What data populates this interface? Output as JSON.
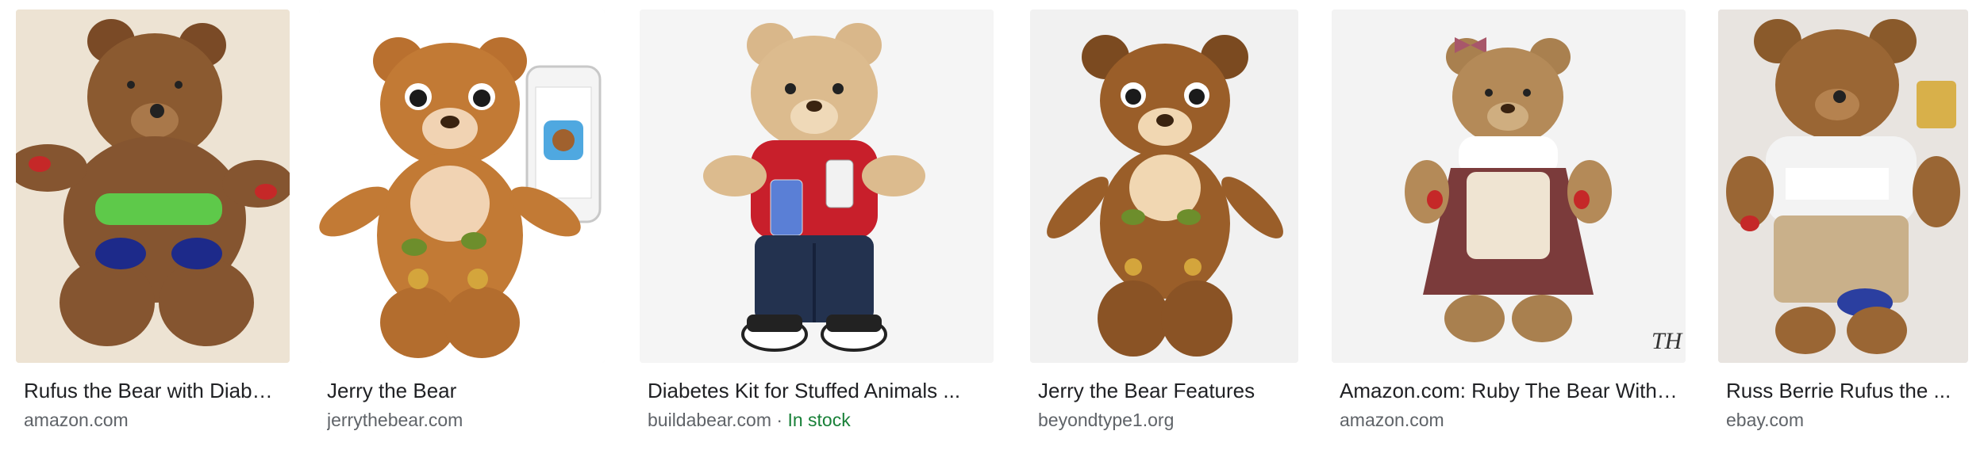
{
  "results": [
    {
      "title": "Rufus the Bear with Diab…",
      "source": "amazon.com",
      "image_description": "Brown plush bear with green belly band and blue patches on legs"
    },
    {
      "title": "Jerry the Bear",
      "source": "jerrythebear.com",
      "image_description": "Cartoon-eyed brown plush bear beside a smartphone showing an app"
    },
    {
      "title": "Diabetes Kit for Stuffed Animals ...",
      "source": "buildabear.com",
      "separator": "·",
      "availability": "In stock",
      "image_description": "Tan plush bear in red shirt and jeans holding diabetes supplies"
    },
    {
      "title": "Jerry the Bear Features",
      "source": "beyondtype1.org",
      "image_description": "Brown plush bear with big eyes and green patches"
    },
    {
      "title": "Amazon.com: Ruby The Bear With…",
      "source": "amazon.com",
      "image_description": "Plush bear wearing checkered apron dress with bow on ear",
      "watermark": "TH"
    },
    {
      "title": "Russ Berrie Rufus the ...",
      "source": "ebay.com",
      "image_description": "Brown plush bear wearing white t-shirt and overalls"
    }
  ],
  "colors": {
    "title": "#202124",
    "source": "#5f6368",
    "in_stock": "#188038"
  }
}
